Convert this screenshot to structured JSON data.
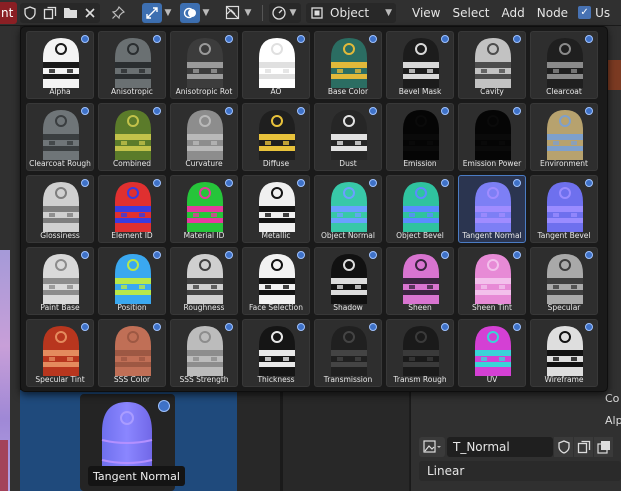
{
  "header": {
    "red_tab": "nt",
    "pin_icon": "pin-icon",
    "object_mode": "Object",
    "menus": [
      "View",
      "Select",
      "Add",
      "Node"
    ],
    "use_label": "Us"
  },
  "tiles": [
    {
      "label": "Alpha",
      "style": "alpha"
    },
    {
      "label": "Anisotropic",
      "style": "aniso"
    },
    {
      "label": "Anisotropic Rot",
      "style": "anisorot"
    },
    {
      "label": "AO",
      "style": "ao"
    },
    {
      "label": "Base Color",
      "style": "basecolor"
    },
    {
      "label": "Bevel Mask",
      "style": "bevelmask"
    },
    {
      "label": "Cavity",
      "style": "cavity"
    },
    {
      "label": "Clearcoat",
      "style": "clearcoat"
    },
    {
      "label": "Clearcoat Rough",
      "style": "ccrough"
    },
    {
      "label": "Combined",
      "style": "combined"
    },
    {
      "label": "Curvature",
      "style": "curvature"
    },
    {
      "label": "Diffuse",
      "style": "diffuse"
    },
    {
      "label": "Dust",
      "style": "dust"
    },
    {
      "label": "Emission",
      "style": "emission"
    },
    {
      "label": "Emission Power",
      "style": "emissionpower"
    },
    {
      "label": "Environment",
      "style": "environment"
    },
    {
      "label": "Glossiness",
      "style": "gloss"
    },
    {
      "label": "Element ID",
      "style": "elementid"
    },
    {
      "label": "Material ID",
      "style": "materialid"
    },
    {
      "label": "Metallic",
      "style": "metallic"
    },
    {
      "label": "Object Normal",
      "style": "objnormal"
    },
    {
      "label": "Object Bevel",
      "style": "objbevel"
    },
    {
      "label": "Tangent Normal",
      "style": "tannormal"
    },
    {
      "label": "Tangent Bevel",
      "style": "tanbevel"
    },
    {
      "label": "Paint Base",
      "style": "paintbase"
    },
    {
      "label": "Position",
      "style": "position"
    },
    {
      "label": "Roughness",
      "style": "roughness"
    },
    {
      "label": "Face Selection",
      "style": "facesel"
    },
    {
      "label": "Shadow",
      "style": "shadow"
    },
    {
      "label": "Sheen",
      "style": "sheen"
    },
    {
      "label": "Sheen Tint",
      "style": "sheentint"
    },
    {
      "label": "Specular",
      "style": "specular"
    },
    {
      "label": "Specular Tint",
      "style": "spectint"
    },
    {
      "label": "SSS Color",
      "style": "ssscolor"
    },
    {
      "label": "SSS Strength",
      "style": "sssstrength"
    },
    {
      "label": "Thickness",
      "style": "thickness"
    },
    {
      "label": "Transmission",
      "style": "transmission"
    },
    {
      "label": "Transm Rough",
      "style": "transmrough"
    },
    {
      "label": "UV",
      "style": "uv"
    },
    {
      "label": "Wireframe",
      "style": "wireframe"
    }
  ],
  "selected_index": 22,
  "preview": {
    "label": "Tangent Normal"
  },
  "texture": {
    "name": "T_Normal",
    "interpolation": "Linear"
  },
  "right_labels": {
    "co": "Co",
    "alp": "Alp"
  },
  "colors": {
    "accent": "#4772b3",
    "selected_border": "#4b7cc4"
  }
}
